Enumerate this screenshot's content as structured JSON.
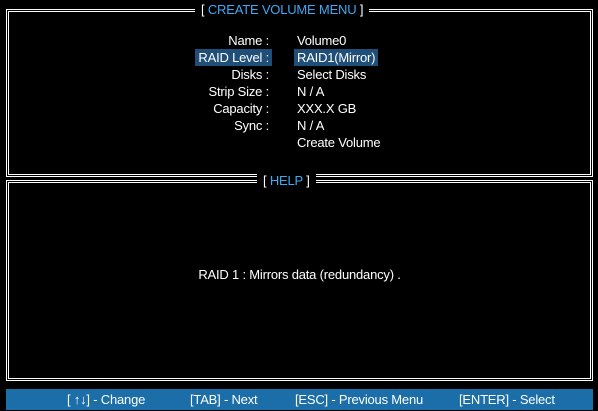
{
  "menu": {
    "title_left": "[",
    "title": "CREATE VOLUME MENU",
    "title_right": "]",
    "fields": [
      {
        "label": "Name :",
        "value": "Volume0"
      },
      {
        "label": "RAID Level :",
        "value": "RAID1(Mirror)"
      },
      {
        "label": "Disks :",
        "value": "Select Disks"
      },
      {
        "label": "Strip Size :",
        "value": "N / A"
      },
      {
        "label": "Capacity :",
        "value": "XXX.X GB"
      },
      {
        "label": "Sync :",
        "value": "N / A"
      }
    ],
    "create_label": "Create Volume"
  },
  "help": {
    "title_left": "[",
    "title": "HELP",
    "title_right": "]",
    "text": "RAID 1 : Mirrors data (redundancy) ."
  },
  "statusbar": {
    "change": "[ ↑↓] - Change",
    "next": "[TAB] - Next",
    "previous": "[ESC] - Previous Menu",
    "select": "[ENTER] - Select"
  },
  "colors": {
    "accent": "#3fa9f5",
    "highlight": "#1f4e79",
    "statusbar": "#1b6ea8"
  }
}
